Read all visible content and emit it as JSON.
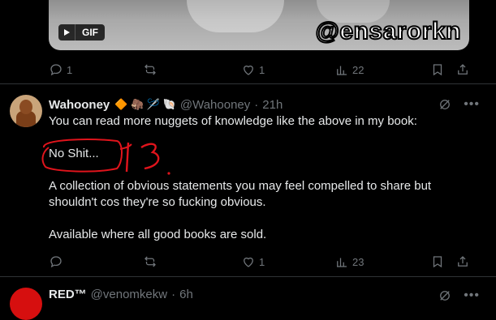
{
  "media": {
    "badge_label": "GIF",
    "watermark": "@ensarorkn",
    "play_icon": "play-icon"
  },
  "post1_actions": {
    "reply_count": "1",
    "repost_count": "",
    "like_count": "1",
    "views_count": "22"
  },
  "post2": {
    "author_name": "Wahooney",
    "badges": "🔶 🦣 🪡 🐚",
    "handle": "@Wahooney",
    "separator": "·",
    "time": "21h",
    "line1": "You can read more nuggets of knowledge like the above in my book:",
    "line2": "No Shit...",
    "line3": "A collection of obvious statements you may feel compelled to share but shouldn't cos they're so fucking obvious.",
    "line4": "Available where all good books are sold.",
    "annotation_color": "#e0141c",
    "actions": {
      "reply_count": "",
      "repost_count": "",
      "like_count": "1",
      "views_count": "23"
    }
  },
  "post3": {
    "author_name": "RED™",
    "handle": "@venomkekw",
    "separator": "·",
    "time": "6h",
    "avatar_color": "#d60f0f"
  },
  "colors": {
    "background": "#000000",
    "text": "#e7e9ea",
    "muted": "#71767b",
    "divider": "#2f3336"
  }
}
